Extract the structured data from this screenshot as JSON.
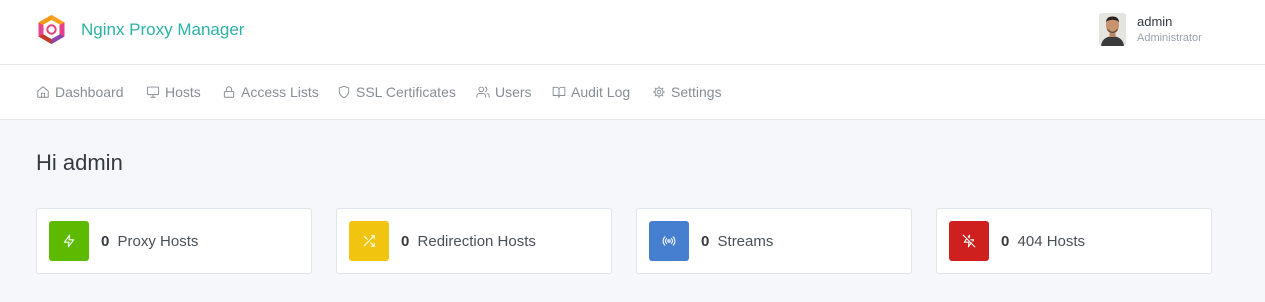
{
  "app": {
    "title": "Nginx Proxy Manager",
    "logo": "nginx-proxy-manager-logo",
    "brand_color": "#2bb3a6"
  },
  "user": {
    "name": "admin",
    "role": "Administrator",
    "avatar": "user-avatar-photo"
  },
  "nav": {
    "items": [
      {
        "label": "Dashboard",
        "icon": "home-icon"
      },
      {
        "label": "Hosts",
        "icon": "monitor-icon"
      },
      {
        "label": "Access Lists",
        "icon": "lock-icon"
      },
      {
        "label": "SSL Certificates",
        "icon": "shield-icon"
      },
      {
        "label": "Users",
        "icon": "users-icon"
      },
      {
        "label": "Audit Log",
        "icon": "book-icon"
      },
      {
        "label": "Settings",
        "icon": "gear-icon"
      }
    ]
  },
  "main": {
    "greeting": "Hi admin",
    "cards": [
      {
        "count": "0",
        "label": "Proxy Hosts",
        "icon": "zap-icon",
        "color": "#5eba00"
      },
      {
        "count": "0",
        "label": "Redirection Hosts",
        "icon": "shuffle-icon",
        "color": "#f1c40f"
      },
      {
        "count": "0",
        "label": "Streams",
        "icon": "radio-icon",
        "color": "#467fcf"
      },
      {
        "count": "0",
        "label": "404 Hosts",
        "icon": "zap-off-icon",
        "color": "#cd201f"
      }
    ]
  }
}
